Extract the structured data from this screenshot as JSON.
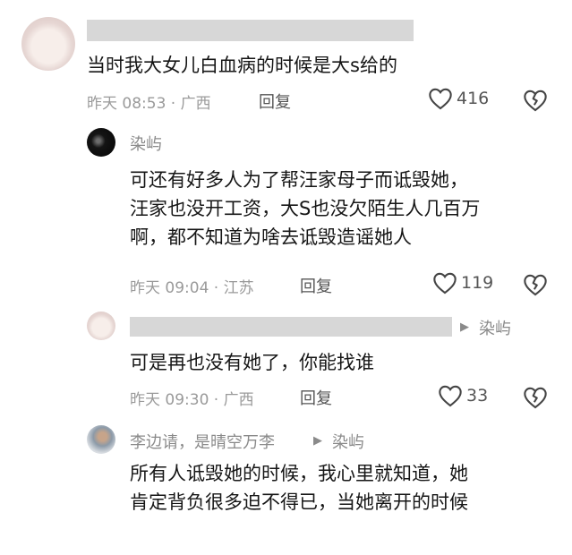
{
  "comments": [
    {
      "text_lines": [
        "当时我大女儿白血病的时候是大s给的"
      ],
      "meta": "昨天 08:53 · 广西",
      "reply_label": "回复",
      "likes": "416"
    },
    {
      "author": "染屿",
      "text_lines": [
        "可还有好多人为了帮汪家母子而诋毁她，",
        "汪家也没开工资，大S也没欠陌生人几百万",
        "啊，都不知道为啥去诋毁造谣她人"
      ],
      "meta": "昨天 09:04 · 江苏",
      "reply_label": "回复",
      "likes": "119"
    },
    {
      "reply_to": "染屿",
      "text_lines": [
        "可是再也没有她了，你能找谁"
      ],
      "meta": "昨天 09:30 · 广西",
      "reply_label": "回复",
      "likes": "33"
    },
    {
      "author": "李边请，是晴空万李",
      "reply_to": "染屿",
      "text_lines": [
        "所有人诋毁她的时候，我心里就知道，她",
        "肯定背负很多迫不得已，当她离开的时候"
      ]
    }
  ],
  "icons": {
    "like": "heart-outline-icon",
    "dislike": "broken-heart-icon",
    "reply_arrow": "play-triangle-icon"
  },
  "colors": {
    "text": "#161616",
    "meta": "#9a9a9a",
    "redaction": "#d7d7d7"
  }
}
